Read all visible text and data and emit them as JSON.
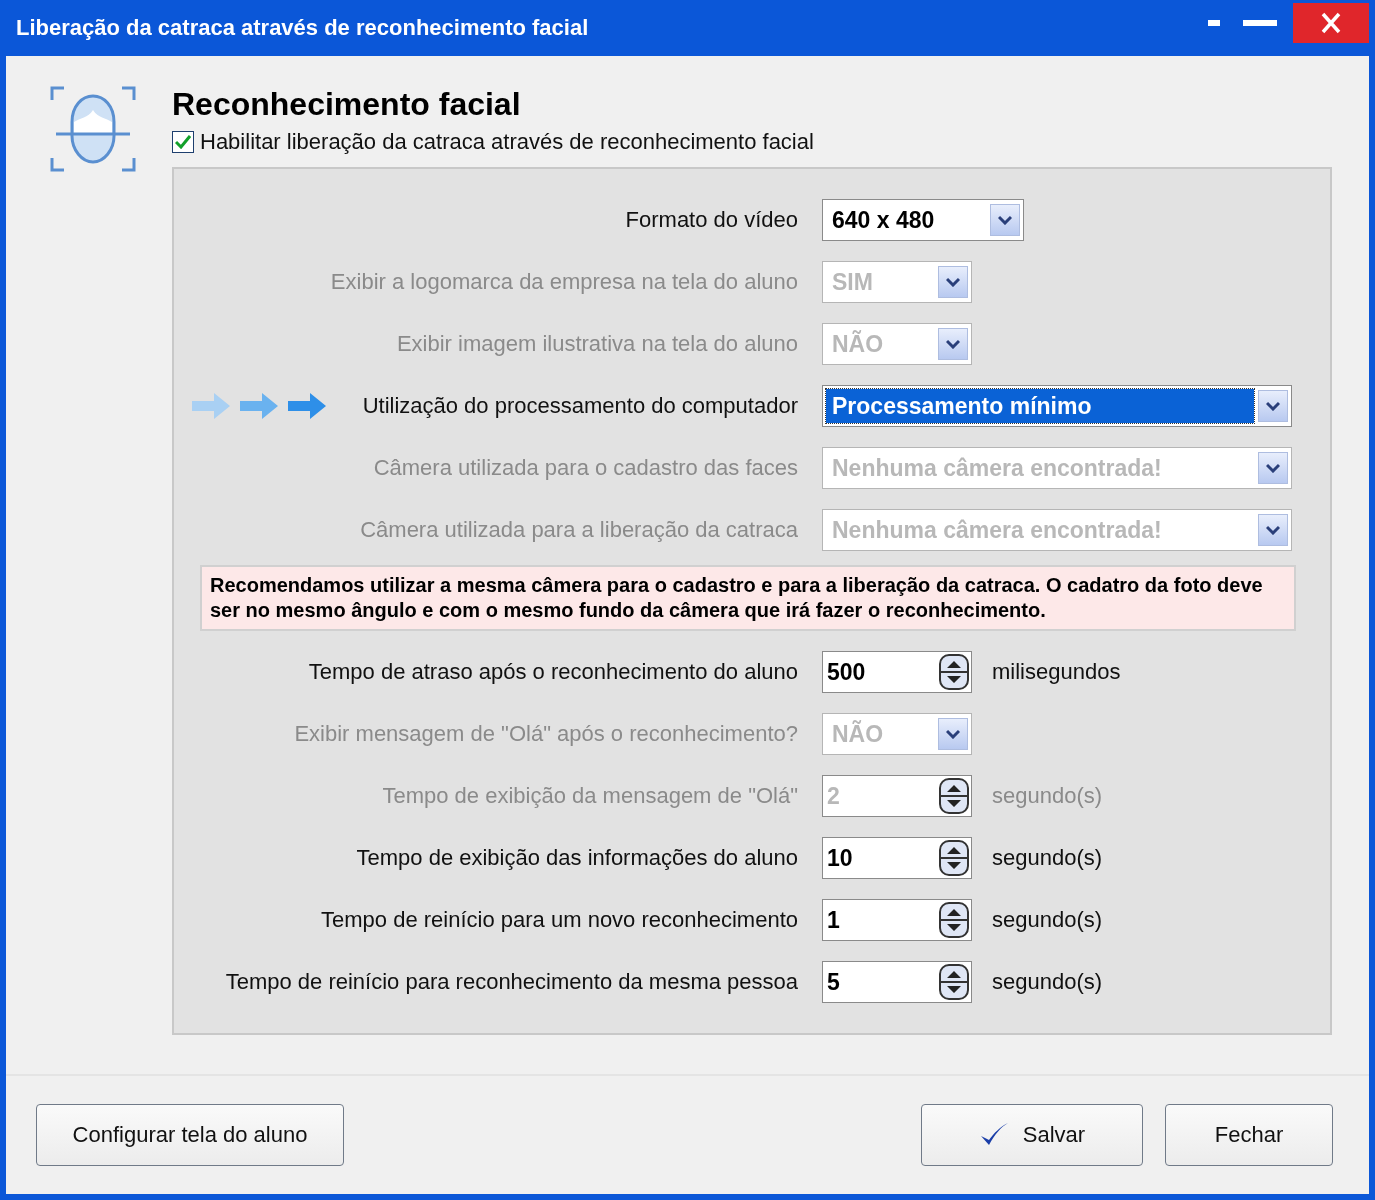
{
  "window": {
    "title": "Liberação da catraca através de reconhecimento facial"
  },
  "header": {
    "title": "Reconhecimento facial",
    "enable_checkbox": {
      "label": "Habilitar liberação da catraca através de reconhecimento facial",
      "checked": true
    }
  },
  "settings": [
    {
      "kind": "select",
      "label": "Formato do vídeo",
      "value": "640 x 480",
      "disabled": false,
      "focused": false,
      "pointed": false
    },
    {
      "kind": "short_select",
      "label": "Exibir a logomarca da empresa na tela do aluno",
      "value": "SIM",
      "disabled": true,
      "focused": false,
      "pointed": false
    },
    {
      "kind": "short_select",
      "label": "Exibir imagem ilustrativa na tela do aluno",
      "value": "NÃO",
      "disabled": true,
      "focused": false,
      "pointed": false
    },
    {
      "kind": "wide_select",
      "label": "Utilização do processamento do computador",
      "value": "Processamento mínimo",
      "disabled": false,
      "focused": true,
      "pointed": true
    },
    {
      "kind": "wide_select",
      "label": "Câmera utilizada para o cadastro das faces",
      "value": "Nenhuma câmera encontrada!",
      "disabled": true,
      "focused": false,
      "pointed": false
    },
    {
      "kind": "wide_select",
      "label": "Câmera utilizada para a liberação da catraca",
      "value": "Nenhuma câmera encontrada!",
      "disabled": true,
      "focused": false,
      "pointed": false
    },
    {
      "kind": "notice",
      "text": "Recomendamos utilizar a mesma câmera para o cadastro e para a liberação da catraca. O cadatro da foto deve ser no mesmo ângulo e com o mesmo fundo da câmera que irá fazer o reconhecimento."
    },
    {
      "kind": "spin",
      "label": "Tempo de atraso após o reconhecimento do aluno",
      "value": "500",
      "unit": "milisegundos",
      "disabled": false,
      "focused": false,
      "pointed": false
    },
    {
      "kind": "short_select",
      "label": "Exibir mensagem de \"Olá\" após o reconhecimento?",
      "value": "NÃO",
      "disabled": true,
      "focused": false,
      "pointed": false
    },
    {
      "kind": "spin",
      "label": "Tempo de exibição da mensagem de \"Olá\"",
      "value": "2",
      "unit": "segundo(s)",
      "disabled": true,
      "focused": false,
      "pointed": false
    },
    {
      "kind": "spin",
      "label": "Tempo de exibição das informações do aluno",
      "value": "10",
      "unit": "segundo(s)",
      "disabled": false,
      "focused": false,
      "pointed": false
    },
    {
      "kind": "spin",
      "label": "Tempo de reinício para um novo reconhecimento",
      "value": "1",
      "unit": "segundo(s)",
      "disabled": false,
      "focused": false,
      "pointed": false
    },
    {
      "kind": "spin",
      "label": "Tempo de reinício para reconhecimento da mesma pessoa",
      "value": "5",
      "unit": "segundo(s)",
      "disabled": false,
      "focused": false,
      "pointed": false
    }
  ],
  "footer": {
    "left_button": "Configurar tela do aluno",
    "save_button": "Salvar",
    "close_button": "Fechar"
  }
}
